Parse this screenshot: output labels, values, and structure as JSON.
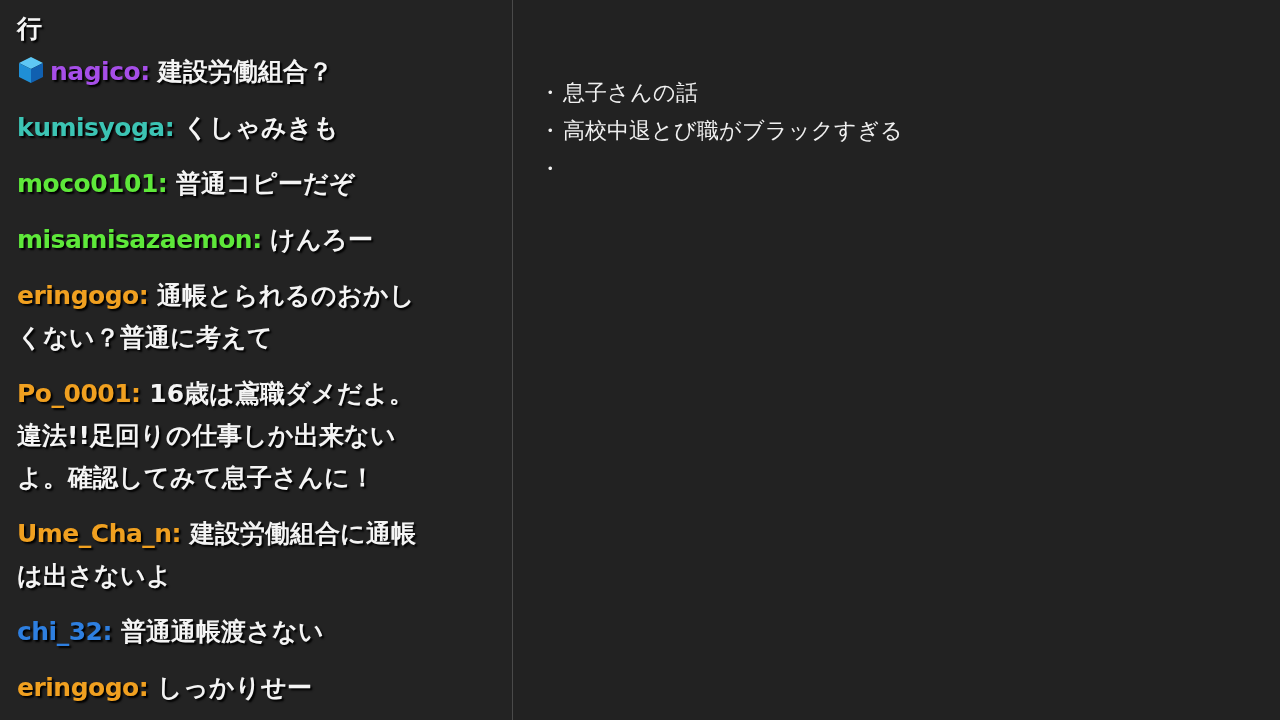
{
  "chat": {
    "messages": [
      {
        "kind": "continuation",
        "text": "行"
      },
      {
        "kind": "message",
        "badge": true,
        "author": "nagico:",
        "color": "#a64ee8",
        "text": [
          "建設労働組合？"
        ]
      },
      {
        "kind": "message",
        "badge": false,
        "author": "kumisyoga:",
        "color": "#3cc4b4",
        "text": [
          "くしゃみきも"
        ]
      },
      {
        "kind": "message",
        "badge": false,
        "author": "moco0101:",
        "color": "#5ee83a",
        "text": [
          "普通コピーだぞ"
        ]
      },
      {
        "kind": "message",
        "badge": false,
        "author": "misamisazaemon:",
        "color": "#5ee83a",
        "text": [
          "けんろー"
        ]
      },
      {
        "kind": "message",
        "badge": false,
        "author": "eringogo:",
        "color": "#f0a020",
        "text": [
          "通帳とられるのおかし",
          "くない？普通に考えて"
        ]
      },
      {
        "kind": "message",
        "badge": false,
        "author": "Po_0001:",
        "color": "#f0a020",
        "text": [
          "16歳は鳶職ダメだよ。",
          "違法!!足回りの仕事しか出来ない",
          "よ。確認してみて息子さんに！"
        ]
      },
      {
        "kind": "message",
        "badge": false,
        "author": "Ume_Cha_n:",
        "color": "#f0a020",
        "text": [
          "建設労働組合に通帳",
          "は出さないよ"
        ]
      },
      {
        "kind": "message",
        "badge": false,
        "author": "chi_32:",
        "color": "#2e7fe0",
        "text": [
          "普通通帳渡さない"
        ]
      },
      {
        "kind": "message",
        "badge": false,
        "author": "eringogo:",
        "color": "#f0a020",
        "text": [
          "しっかりせー"
        ]
      }
    ]
  },
  "notes": {
    "items": [
      {
        "bullet": "・",
        "text": "息子さんの話"
      },
      {
        "bullet": "・",
        "text": "高校中退とび職がブラックすぎる"
      },
      {
        "bullet": "・"
      }
    ]
  }
}
